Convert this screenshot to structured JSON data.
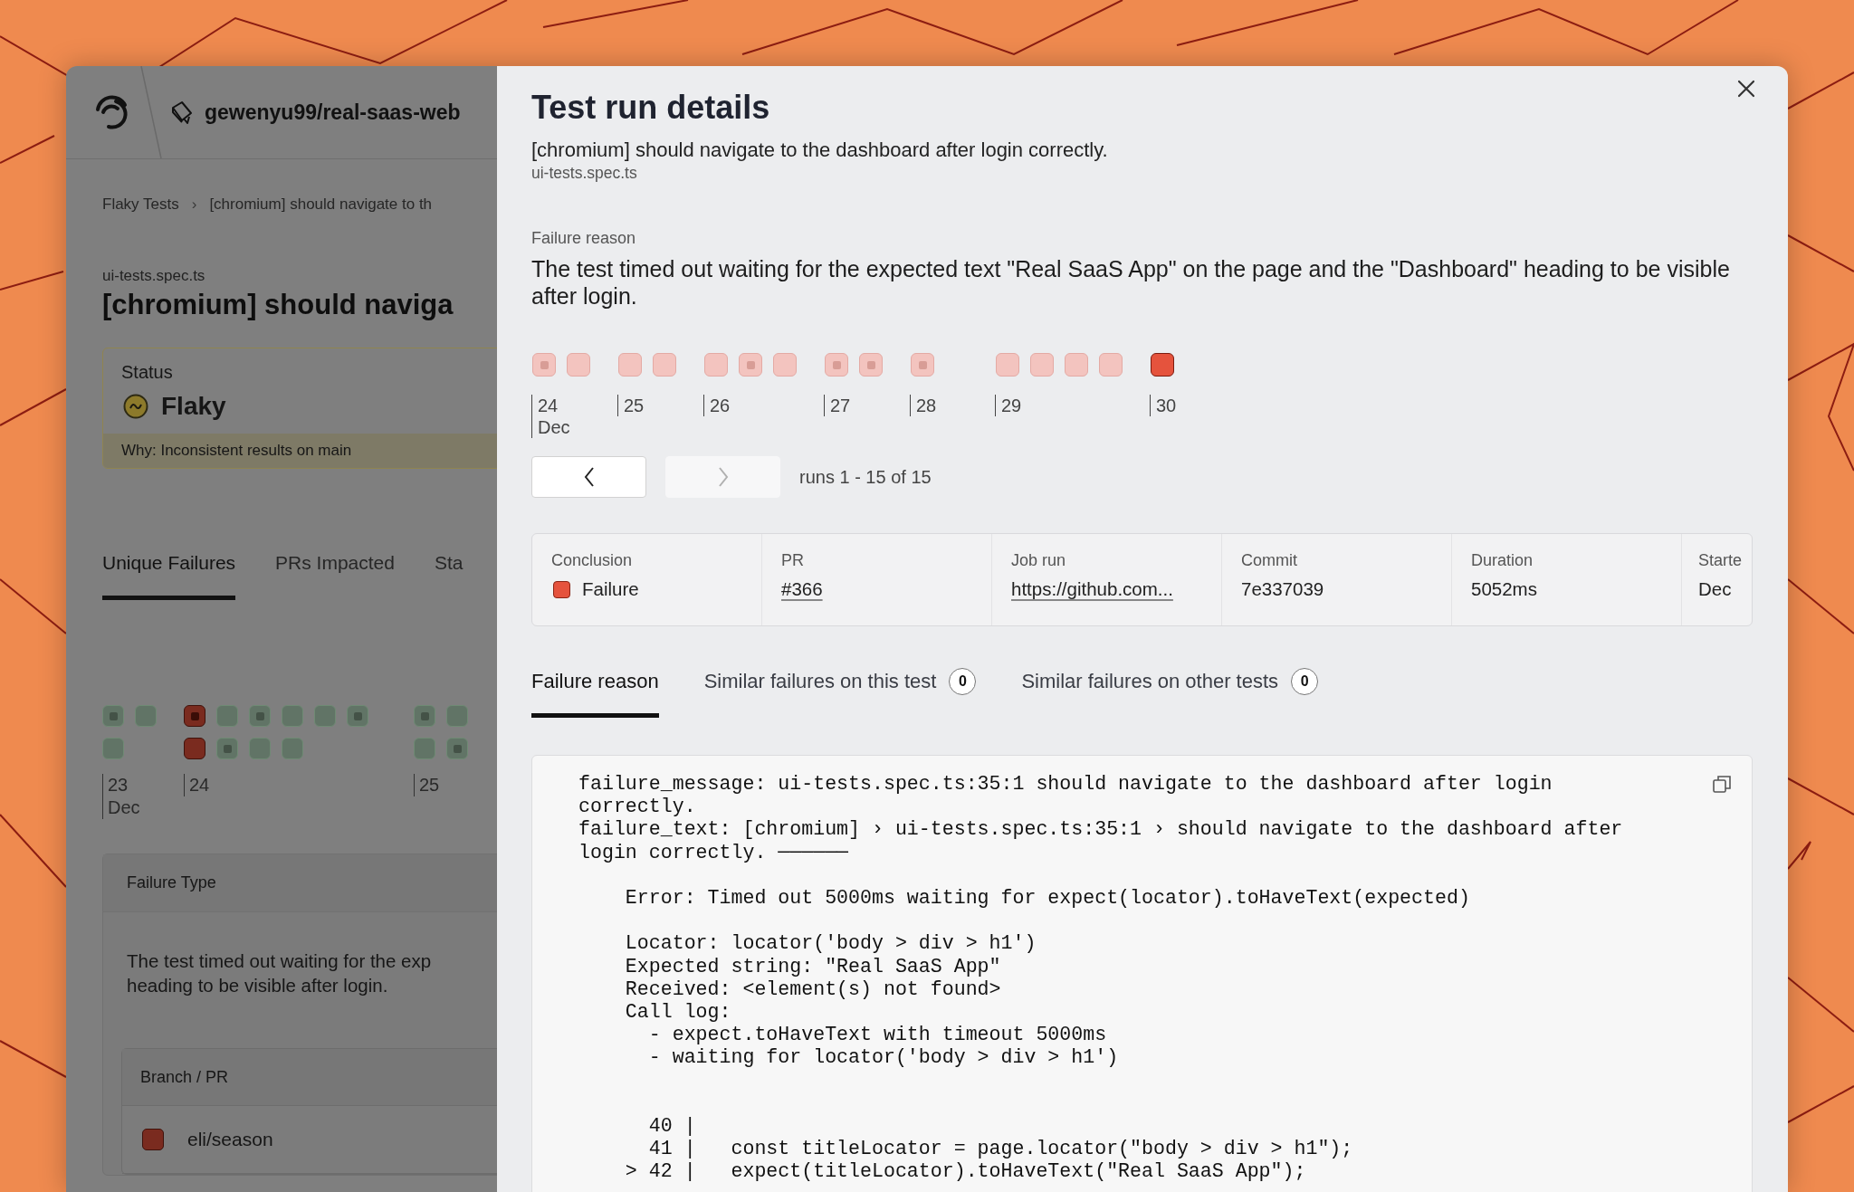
{
  "app": {
    "repo": "gewenyu99/real-saas-web",
    "breadcrumb": {
      "items": [
        "Flaky Tests",
        "[chromium] should navigate to th"
      ],
      "separator": "›"
    },
    "test": {
      "file": "ui-tests.spec.ts",
      "title": "[chromium] should naviga"
    },
    "status": {
      "label": "Status",
      "value": "Flaky",
      "kind": "flaky",
      "reason": "Why: Inconsistent results on main"
    },
    "tabs": [
      {
        "label": "Unique Failures",
        "selected": true
      },
      {
        "label": "PRs Impacted",
        "selected": false
      },
      {
        "label": "Sta",
        "selected": false
      }
    ],
    "history": {
      "days": [
        {
          "label": "23",
          "month": "Dec",
          "rows": [
            [
              {
                "failed": false,
                "dotted": true
              },
              {
                "failed": false,
                "dotted": false
              }
            ],
            [
              {
                "failed": false,
                "dotted": false
              }
            ]
          ]
        },
        {
          "label": "24",
          "rows": [
            [
              {
                "failed": true,
                "dotted": true
              },
              {
                "failed": false,
                "dotted": false
              },
              {
                "failed": false,
                "dotted": true
              },
              {
                "failed": false,
                "dotted": false
              },
              {
                "failed": false,
                "dotted": false
              },
              {
                "failed": false,
                "dotted": true
              }
            ],
            [
              {
                "failed": true,
                "dotted": false
              },
              {
                "failed": false,
                "dotted": true
              },
              {
                "failed": false,
                "dotted": false
              },
              {
                "failed": false,
                "dotted": false
              }
            ]
          ]
        },
        {
          "label": "25",
          "rows": [
            [
              {
                "failed": false,
                "dotted": true
              },
              {
                "failed": false,
                "dotted": false
              }
            ],
            [
              {
                "failed": false,
                "dotted": false
              },
              {
                "failed": false,
                "dotted": true
              }
            ]
          ]
        }
      ]
    },
    "failure_type": {
      "header": "Failure Type",
      "lines": [
        "The test timed out waiting for the exp",
        "heading to be visible after login."
      ]
    },
    "branches": {
      "header": "Branch / PR",
      "rows": [
        {
          "name": "eli/season",
          "failed": true
        }
      ]
    }
  },
  "modal": {
    "title": "Test run details",
    "test_name": "[chromium] should navigate to the dashboard after login correctly.",
    "file": "ui-tests.spec.ts",
    "reason_label": "Failure reason",
    "reason": "The test timed out waiting for the expected text \"Real SaaS App\" on the page and the \"Dashboard\" heading to be visible after login.",
    "runs": {
      "days": [
        {
          "label": "24",
          "month": "Dec",
          "runs": [
            {
              "dotted": true,
              "selected": false
            },
            {
              "dotted": false,
              "selected": false
            }
          ]
        },
        {
          "label": "25",
          "runs": [
            {
              "dotted": false,
              "selected": false
            },
            {
              "dotted": false,
              "selected": false
            }
          ]
        },
        {
          "label": "26",
          "runs": [
            {
              "dotted": false,
              "selected": false
            },
            {
              "dotted": true,
              "selected": false
            },
            {
              "dotted": false,
              "selected": false
            }
          ]
        },
        {
          "label": "27",
          "runs": [
            {
              "dotted": true,
              "selected": false
            },
            {
              "dotted": true,
              "selected": false
            }
          ]
        },
        {
          "label": "28",
          "runs": [
            {
              "dotted": true,
              "selected": false
            }
          ]
        },
        {
          "label": "29",
          "runs": [
            {
              "dotted": false,
              "selected": false
            },
            {
              "dotted": false,
              "selected": false
            },
            {
              "dotted": false,
              "selected": false
            },
            {
              "dotted": false,
              "selected": false
            }
          ]
        },
        {
          "label": "30",
          "runs": [
            {
              "dotted": false,
              "selected": true
            }
          ]
        }
      ]
    },
    "pager": {
      "prev": {
        "disabled": false
      },
      "next": {
        "disabled": true
      },
      "text": "runs 1 - 15 of 15"
    },
    "details": [
      {
        "label": "Conclusion",
        "value": "Failure",
        "kind": "status",
        "failed": true
      },
      {
        "label": "PR",
        "value": "#366",
        "kind": "link"
      },
      {
        "label": "Job run",
        "value": "https://github.com...",
        "kind": "link"
      },
      {
        "label": "Commit",
        "value": "7e337039",
        "kind": "text"
      },
      {
        "label": "Duration",
        "value": "5052ms",
        "kind": "text"
      },
      {
        "label": "Starte",
        "value": "Dec",
        "kind": "text"
      }
    ],
    "tabs": [
      {
        "label": "Failure reason",
        "selected": true
      },
      {
        "label": "Similar failures on this test",
        "count": "0",
        "selected": false
      },
      {
        "label": "Similar failures on other tests",
        "count": "0",
        "selected": false
      }
    ],
    "code": "failure_message: ui-tests.spec.ts:35:1 should navigate to the dashboard after login\ncorrectly.\nfailure_text: [chromium] › ui-tests.spec.ts:35:1 › should navigate to the dashboard after\nlogin correctly. ──────\n\n    Error: Timed out 5000ms waiting for expect(locator).toHaveText(expected)\n\n    Locator: locator('body > div > h1')\n    Expected string: \"Real SaaS App\"\n    Received: <element(s) not found>\n    Call log:\n      - expect.toHaveText with timeout 5000ms\n      - waiting for locator('body > div > h1')\n\n\n      40 |\n      41 |   const titleLocator = page.locator(\"body > div > h1\");\n    > 42 |   expect(titleLocator).toHaveText(\"Real SaaS App\");"
  }
}
